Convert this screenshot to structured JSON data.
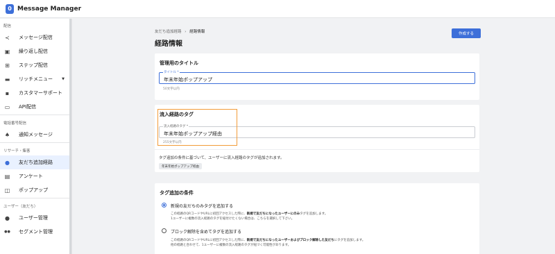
{
  "app": {
    "logo_glyph": "0",
    "title": "Message Manager"
  },
  "sidebar": {
    "sections": [
      {
        "label": "配信",
        "items": [
          {
            "label": "メッセージ配信",
            "icon": "share-icon",
            "glyph": "≺"
          },
          {
            "label": "繰り返し配信",
            "icon": "calendar-repeat-icon",
            "glyph": "▣"
          },
          {
            "label": "ステップ配信",
            "icon": "step-flow-icon",
            "glyph": "⊞"
          },
          {
            "label": "リッチメニュー",
            "icon": "rich-menu-icon",
            "glyph": "▬",
            "caret": "▼"
          },
          {
            "label": "カスタマーサポート",
            "icon": "chat-icon",
            "glyph": "▪"
          },
          {
            "label": "API配信",
            "icon": "api-icon",
            "glyph": "▭"
          }
        ]
      },
      {
        "label": "電話番号配信",
        "items": [
          {
            "label": "通知メッセージ",
            "icon": "bell-icon",
            "glyph": "♠"
          }
        ]
      },
      {
        "label": "リサーチ・集客",
        "items": [
          {
            "label": "友だち追加経路",
            "icon": "location-pin-icon",
            "glyph": "●",
            "active": true
          },
          {
            "label": "アンケート",
            "icon": "survey-icon",
            "glyph": "▤"
          },
          {
            "label": "ポップアップ",
            "icon": "popup-icon",
            "glyph": "◫"
          }
        ]
      },
      {
        "label": "ユーザー（友だち）",
        "items": [
          {
            "label": "ユーザー管理",
            "icon": "user-icon",
            "glyph": "●"
          },
          {
            "label": "セグメント管理",
            "icon": "group-icon",
            "glyph": "●●"
          }
        ]
      }
    ]
  },
  "main": {
    "breadcrumb": {
      "parent": "友だち追加経路",
      "separator": "›",
      "current": "経路情報"
    },
    "page_title": "経路情報",
    "create_button": "作成する",
    "admin_title": {
      "heading": "管理用のタイトル",
      "field_label": "タイトル *",
      "value": "年末年始ポップアップ",
      "hint": "50文字以内"
    },
    "tag": {
      "heading": "流入経路のタグ",
      "field_label": "流入経路のタグ *",
      "value": "年末年始ポップアップ経由",
      "hint": "255文字以内",
      "description": "タグ追加の条件に基づいて、ユーザーに流入経路のタグが追加されます。",
      "chip": "年末年始ポップアップ経由"
    },
    "conditions": {
      "heading": "タグ追加の条件",
      "options": [
        {
          "label": "新規の友だちのみタグを追加する",
          "selected": true,
          "desc1_a": "この経路のQRコードやURLに初回アクセスした際に、",
          "desc1_b": "新規で友だちになったユーザーにのみ",
          "desc1_c": "タグを追加します。",
          "desc2": "1ユーザーに複数の流入経路のタグを紐付けたくない場合は、こちらを選択して下さい。"
        },
        {
          "label": "ブロック解除を含めてタグを追加する",
          "selected": false,
          "desc1_a": "この経路のQRコードやURLに初回アクセスした際に、",
          "desc1_b": "新規で友だちになったユーザーおよびブロック解除した友だち",
          "desc1_c": "にタグを追加します。",
          "desc2": "他の経路と合わせて、1ユーザーに複数の流入経路のタグが紐づく可能性があります。"
        }
      ]
    }
  },
  "colors": {
    "accent": "#3d6fd9",
    "highlight": "#f29b38",
    "active_bg": "#e9f1ff"
  }
}
